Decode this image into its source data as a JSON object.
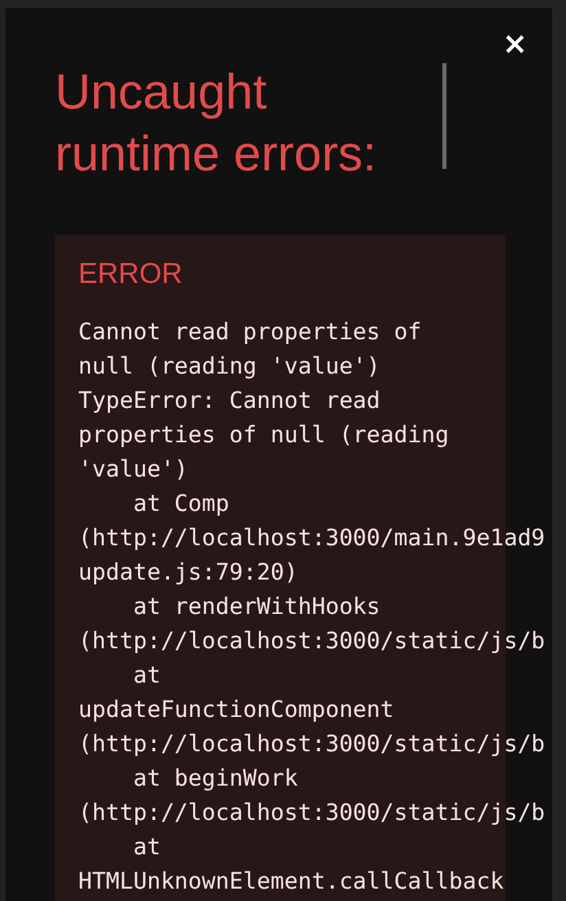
{
  "overlay": {
    "close_button": "×",
    "title": "Uncaught runtime errors:",
    "error": {
      "label": "ERROR",
      "lines": [
        "Cannot read properties of",
        "null (reading 'value')",
        "TypeError: Cannot read",
        "properties of null (reading",
        "'value')",
        "    at Comp",
        "(http://localhost:3000/main.9e1ad9",
        "update.js:79:20)",
        "    at renderWithHooks",
        "(http://localhost:3000/static/js/b",
        "    at",
        "updateFunctionComponent",
        "(http://localhost:3000/static/js/b",
        "    at beginWork",
        "(http://localhost:3000/static/js/b",
        "    at",
        "HTMLUnknownElement.callCallback"
      ]
    }
  }
}
